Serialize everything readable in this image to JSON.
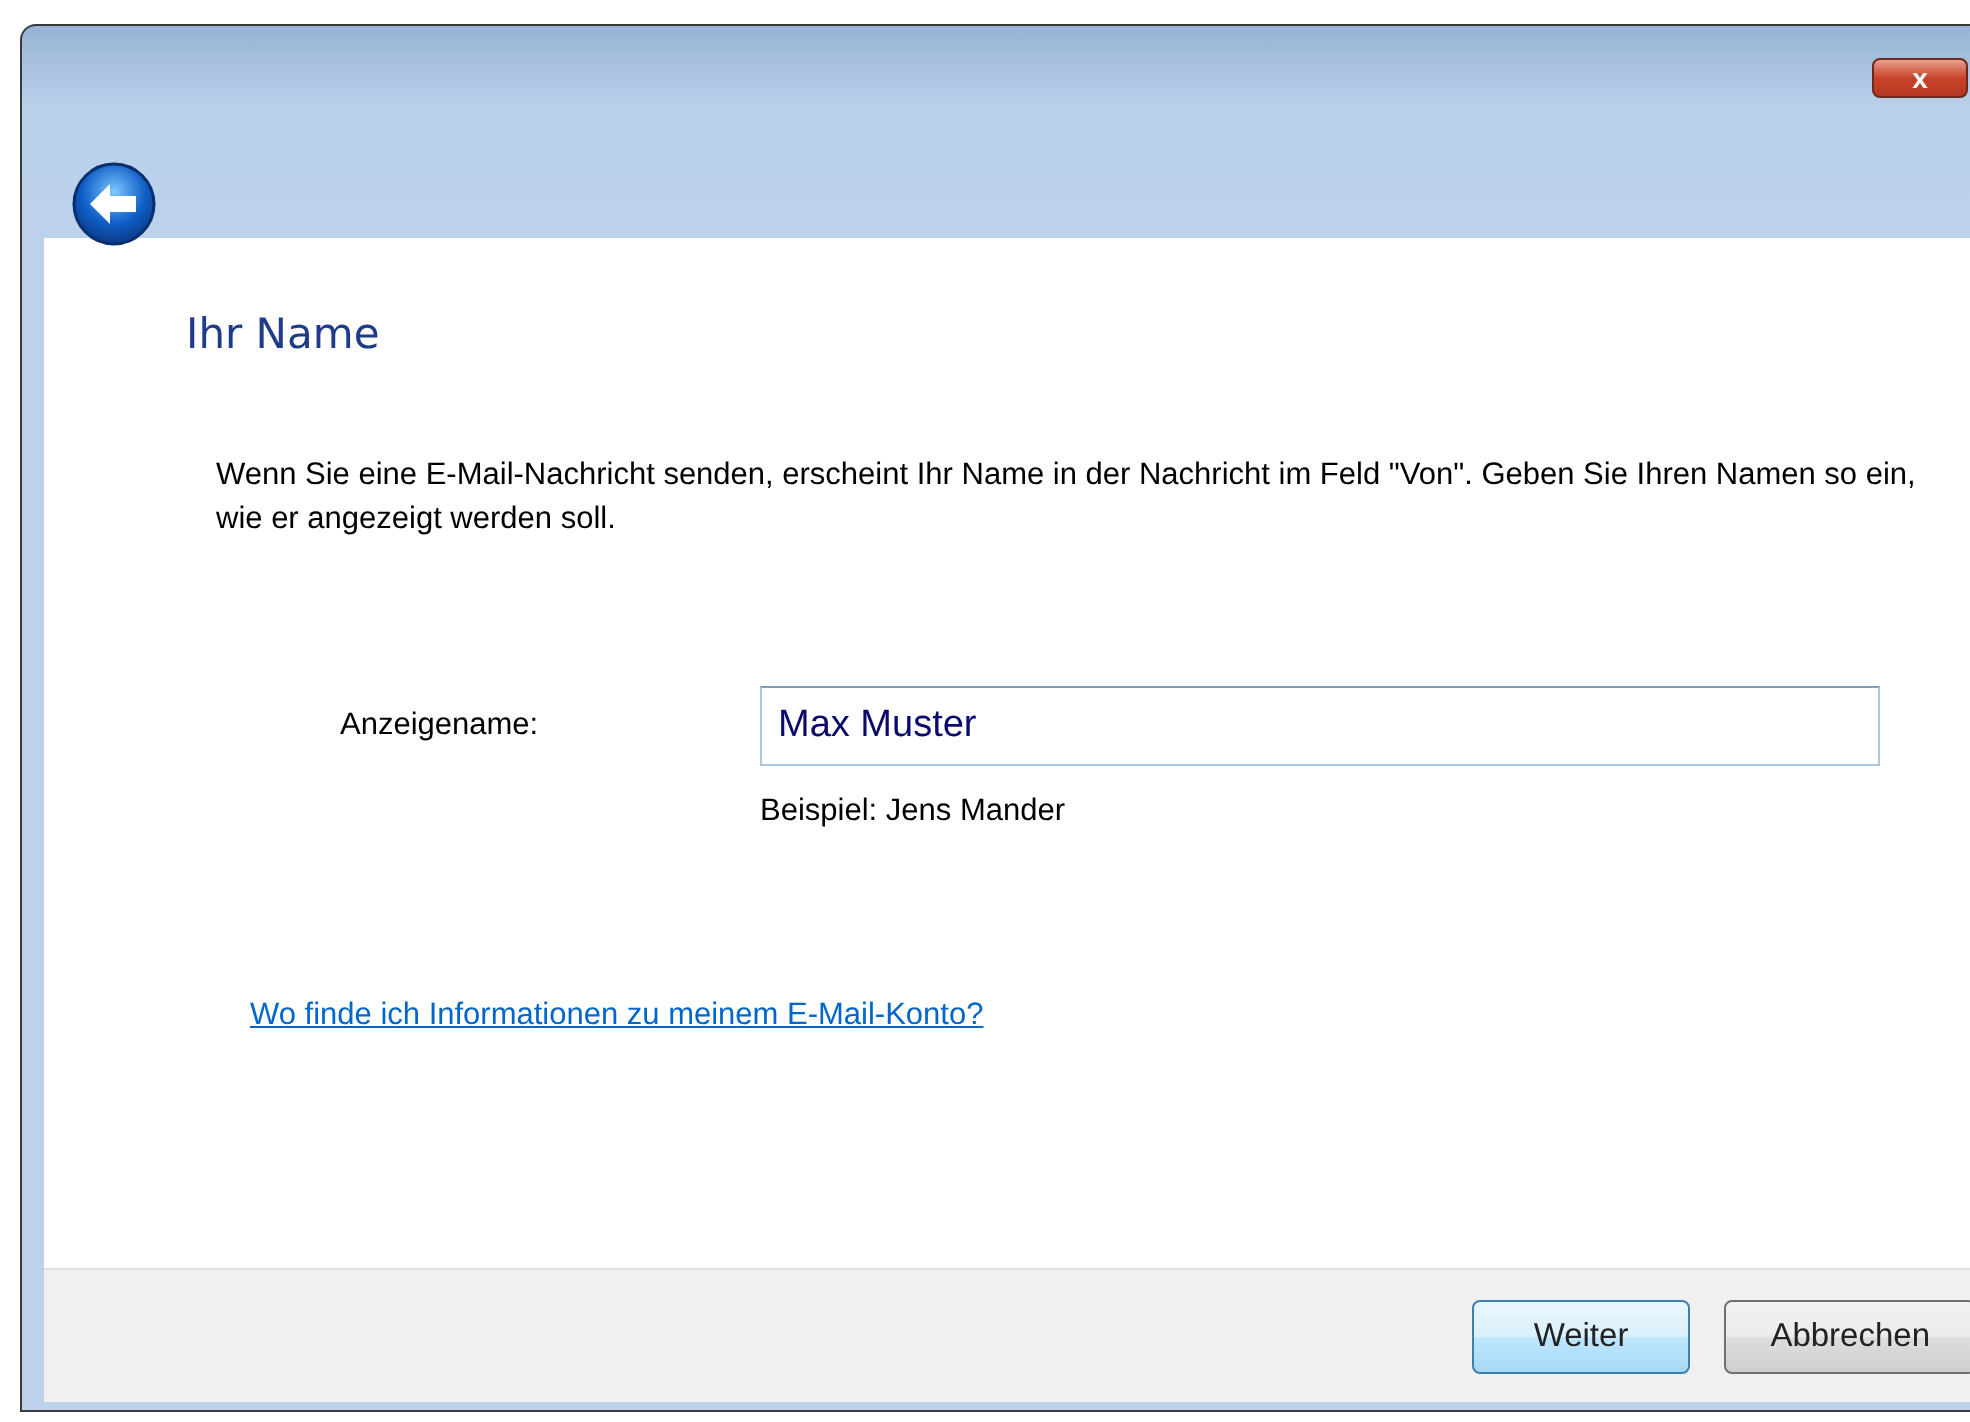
{
  "window": {
    "close_label": "x"
  },
  "heading": "Ihr Name",
  "description": "Wenn Sie eine E-Mail-Nachricht senden, erscheint Ihr Name in der Nachricht im Feld \"Von\". Geben Sie Ihren Namen so ein, wie er angezeigt werden soll.",
  "field": {
    "label": "Anzeigename:",
    "value": "Max Muster",
    "hint": "Beispiel: Jens Mander"
  },
  "link": "Wo finde ich Informationen zu meinem E-Mail-Konto?",
  "buttons": [
    {
      "label": "Weiter",
      "default": true
    },
    {
      "label": "Abbrechen",
      "default": false
    }
  ]
}
